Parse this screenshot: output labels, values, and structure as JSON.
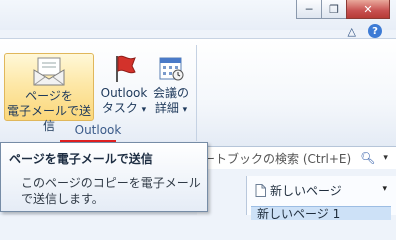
{
  "window": {
    "minimize_glyph": "─",
    "restore_glyph": "❐",
    "close_glyph": "✕"
  },
  "ribbon_controls": {
    "collapse_glyph": "△",
    "help_glyph": "?"
  },
  "ribbon": {
    "group_label": "Outlook",
    "send_page_button": {
      "line1": "ページを",
      "line2": "電子メールで送信"
    },
    "outlook_task_button": {
      "line1": "Outlook",
      "line2": "タスク",
      "dropdown": "▾"
    },
    "meeting_details_button": {
      "line1": "会議の",
      "line2": "詳細",
      "dropdown": "▾"
    }
  },
  "search": {
    "text": "ートブックの検索 (Ctrl+E)",
    "icon": "search-icon",
    "dropdown": "▾"
  },
  "tooltip": {
    "title": "ページを電子メールで送信",
    "body": "このページのコピーを電子メールで送信します。"
  },
  "page_pane": {
    "new_page_label": "新しいページ",
    "new_page_dropdown": "▾",
    "page_item": "新しいページ 1"
  },
  "colors": {
    "highlight": "#fbd77a",
    "accent_red": "#e02020",
    "ribbon_border": "#9fb2cc"
  }
}
